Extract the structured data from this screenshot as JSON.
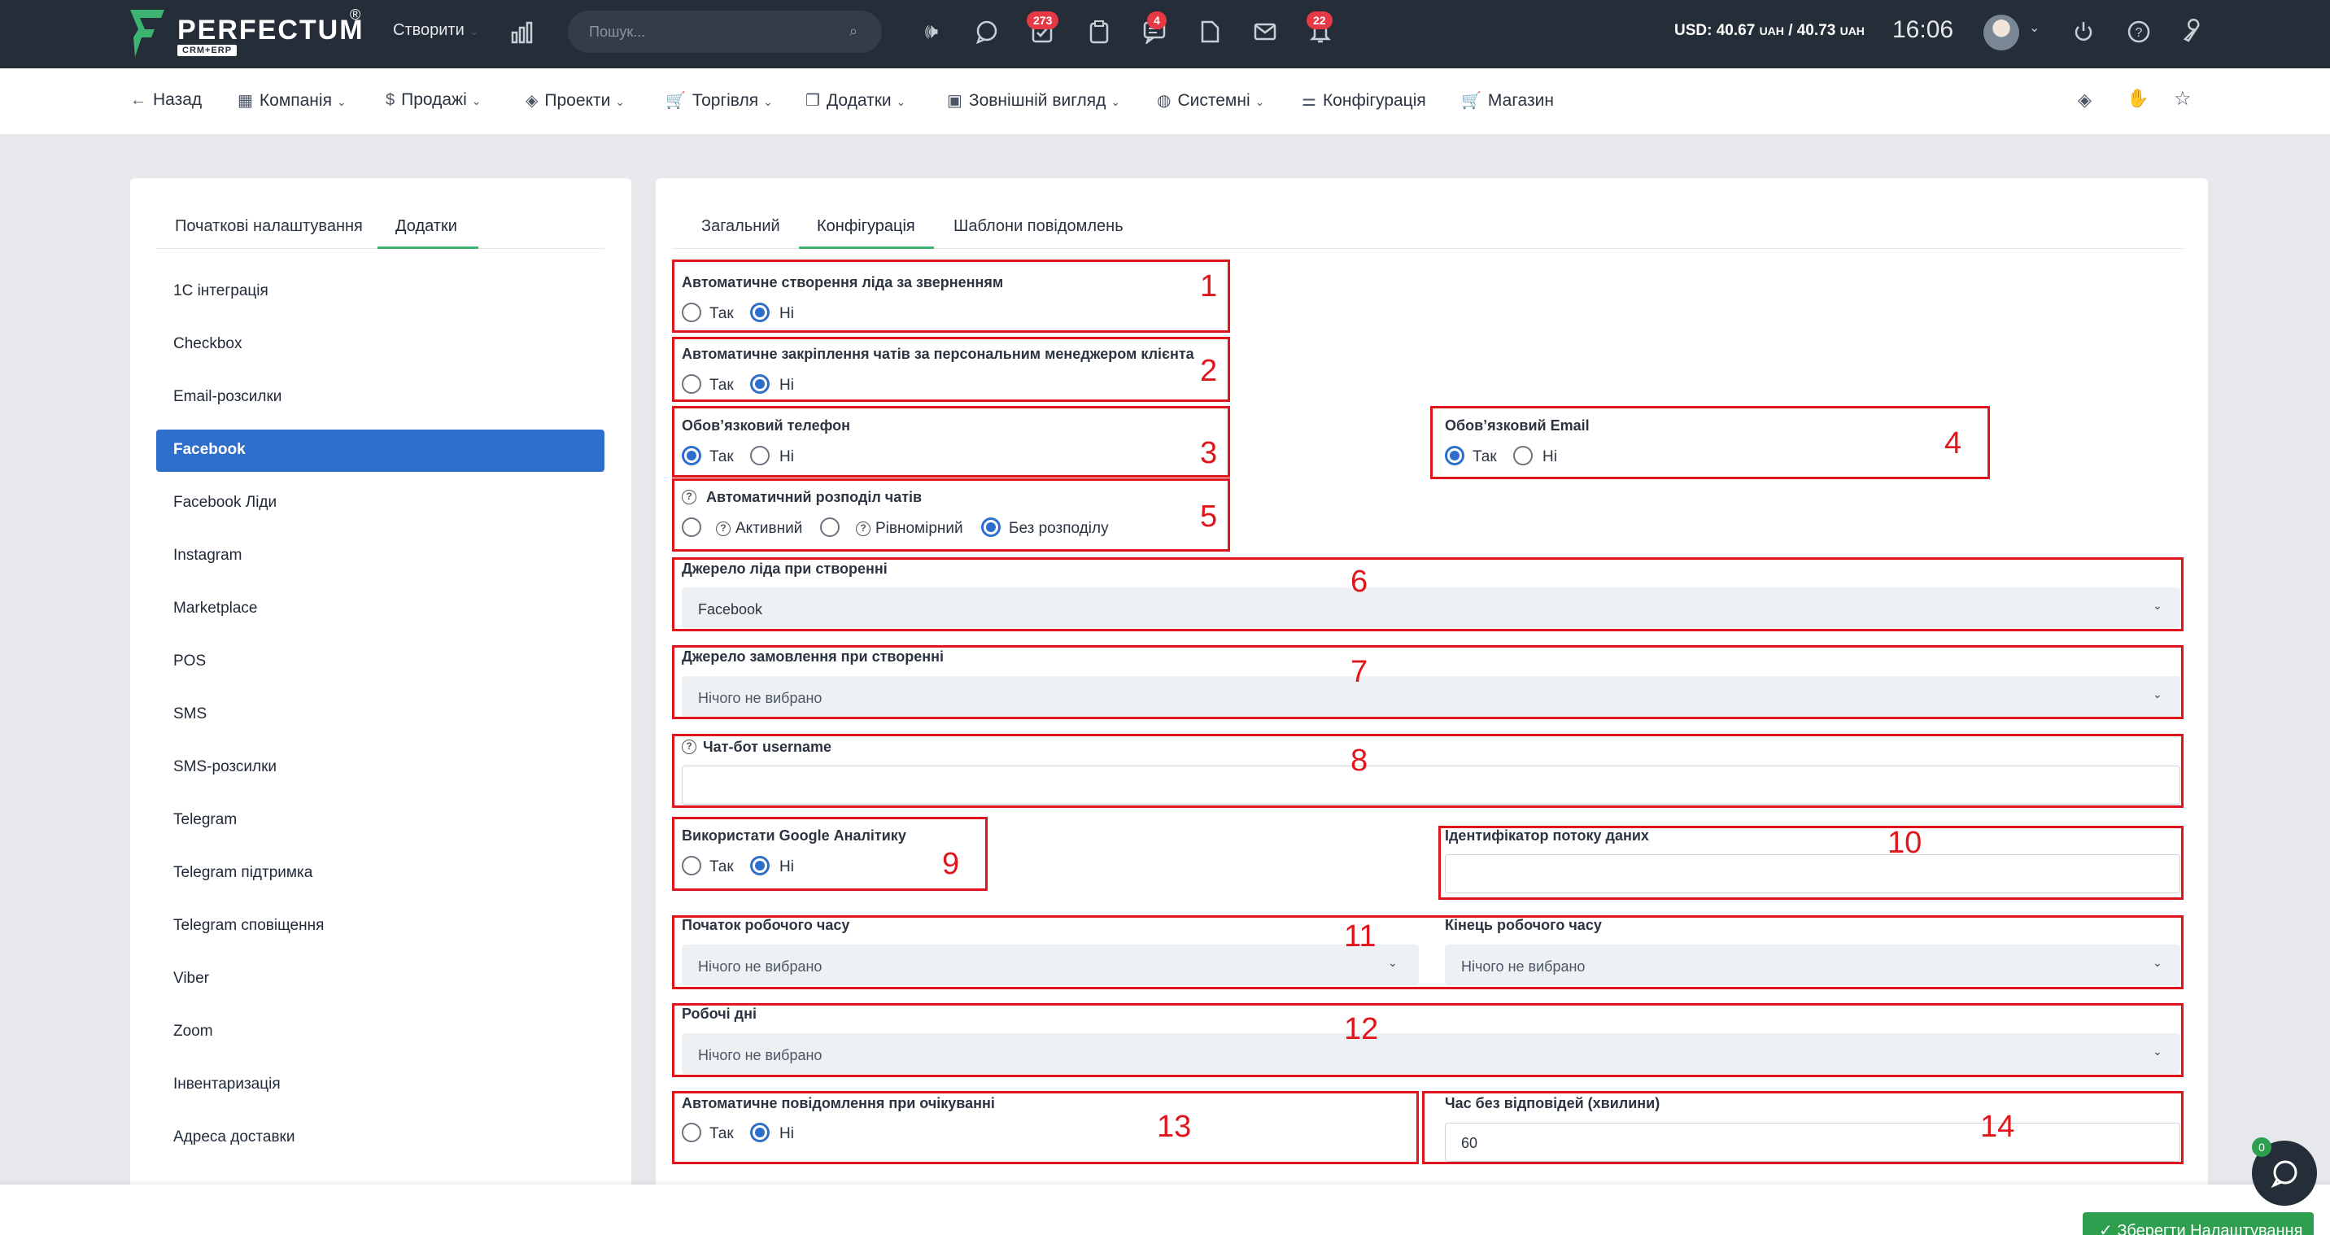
{
  "topbar": {
    "brand": "PERFECTUM",
    "brand_sub": "CRM+ERP",
    "brand_reg": "®",
    "create_label": "Створити",
    "search_placeholder": "Пошук...",
    "badges": {
      "tasks": "273",
      "messages": "4",
      "notifications": "22"
    },
    "currency": {
      "prefix": "USD: 40.67",
      "unit1": "UAH",
      "sep": "/ 40.73",
      "unit2": "UAH"
    },
    "time": "16:06"
  },
  "nav": {
    "back": "Назад",
    "items": [
      "Компанія",
      "Продажі",
      "Проекти",
      "Торгівля",
      "Додатки",
      "Зовнішній вигляд",
      "Системні",
      "Конфігурація",
      "Магазин"
    ]
  },
  "left": {
    "tabs": [
      "Початкові налаштування",
      "Додатки"
    ],
    "items": [
      "1С інтеграція",
      "Checkbox",
      "Email-розсилки",
      "Facebook",
      "Facebook Ліди",
      "Instagram",
      "Marketplace",
      "POS",
      "SMS",
      "SMS-розсилки",
      "Telegram",
      "Telegram підтримка",
      "Telegram сповіщення",
      "Viber",
      "Zoom",
      "Інвентаризація",
      "Адреса доставки"
    ]
  },
  "right": {
    "tabs": [
      "Загальний",
      "Конфігурація",
      "Шаблони повідомлень"
    ]
  },
  "form": {
    "yes": "Так",
    "no": "Ні",
    "f1_label": "Автоматичне створення ліда за зверненням",
    "f2_label": "Автоматичне закріплення чатів за персональним менеджером клієнта",
    "f3_label": "Обовʼязковий телефон",
    "f4_label": "Обовʼязковий Email",
    "f5_label": "Автоматичний розподіл чатів",
    "f5_opt1": "Активний",
    "f5_opt2": "Рівномірний",
    "f5_opt3": "Без розподілу",
    "f6_label": "Джерело ліда при створенні",
    "f6_value": "Facebook",
    "f7_label": "Джерело замовлення при створенні",
    "nothing": "Нічого не вибрано",
    "f8_label": "Чат-бот username",
    "f9_label": "Використати Google Аналітику",
    "f10_label": "Ідентифікатор потоку даних",
    "f11_label": "Початок робочого часу",
    "f11b_label": "Кінець робочого часу",
    "f12_label": "Робочі дні",
    "f13_label": "Автоматичне повідомлення при очікуванні",
    "f14_label": "Час без відповідей (хвилини)",
    "f14_value": "60"
  },
  "annotations": [
    "1",
    "2",
    "3",
    "4",
    "5",
    "6",
    "7",
    "8",
    "9",
    "10",
    "11",
    "12",
    "13",
    "14"
  ],
  "footer": {
    "save": "✓ Зберегти Налаштування",
    "chat_badge": "0"
  },
  "colors": {
    "topbar": "#242d38",
    "accent_blue": "#2e6fcb",
    "accent_green": "#3cb371",
    "save_green": "#2e9e4f",
    "annotation_red": "#e0161d",
    "badge_red": "#e63946"
  }
}
